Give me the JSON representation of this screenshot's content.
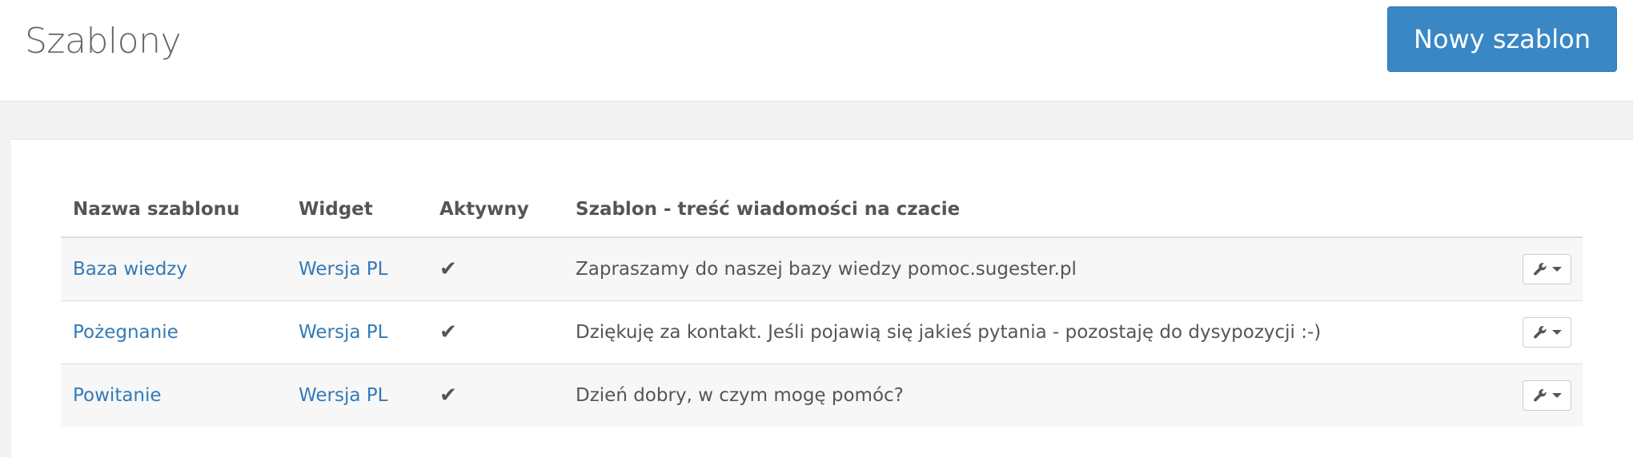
{
  "header": {
    "title": "Szablony",
    "new_button_label": "Nowy szablon"
  },
  "table": {
    "columns": [
      "Nazwa szablonu",
      "Widget",
      "Aktywny",
      "Szablon - treść wiadomości na czacie"
    ],
    "rows": [
      {
        "name": "Baza wiedzy",
        "widget": "Wersja PL",
        "active": "✔",
        "content": "Zapraszamy do naszej bazy wiedzy pomoc.sugester.pl"
      },
      {
        "name": "Pożegnanie",
        "widget": "Wersja PL",
        "active": "✔",
        "content": "Dziękuję za kontakt. Jeśli pojawią się jakieś pytania - pozostaję do dysypozycji :-)"
      },
      {
        "name": "Powitanie",
        "widget": "Wersja PL",
        "active": "✔",
        "content": "Dzień dobry, w czym mogę pomóc?"
      }
    ]
  },
  "icons": {
    "row_action": "wrench-icon",
    "dropdown": "caret-down-icon"
  },
  "colors": {
    "primary_button": "#3a87c6",
    "link": "#337ab7",
    "row_stripe": "#f7f7f7"
  }
}
